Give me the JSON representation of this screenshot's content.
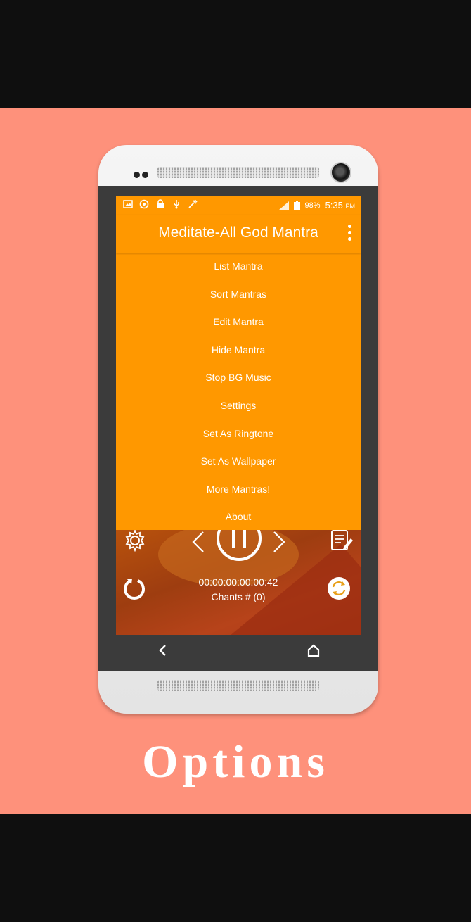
{
  "status_bar": {
    "battery": "98%",
    "time": "5:35",
    "ampm": "PM",
    "left_icons": [
      "image-icon",
      "whatsapp-icon",
      "lock-icon",
      "usb-icon",
      "tool-icon"
    ],
    "right_icons": [
      "signal-icon",
      "battery-icon"
    ]
  },
  "app": {
    "title": "Meditate-All God Mantra",
    "overflow_icon": "kebab-menu-icon"
  },
  "menu": {
    "items": [
      {
        "label": "List Mantra"
      },
      {
        "label": "Sort Mantras"
      },
      {
        "label": "Edit Mantra"
      },
      {
        "label": "Hide Mantra"
      },
      {
        "label": "Stop BG Music"
      },
      {
        "label": "Settings"
      },
      {
        "label": "Set As Ringtone"
      },
      {
        "label": "Set As Wallpaper"
      },
      {
        "label": "More Mantras!"
      },
      {
        "label": "About"
      }
    ]
  },
  "player": {
    "timer": "00:00:00:00:00:42",
    "chants": "Chants # (0)",
    "icons": [
      "gear-icon",
      "prev-icon",
      "pause-icon",
      "next-icon",
      "notes-icon",
      "reset-icon",
      "shuffle-icon"
    ]
  },
  "navbar": {
    "icons": [
      "back-icon",
      "home-icon"
    ]
  },
  "caption": "Options",
  "colors": {
    "poster_bg": "#fe917b",
    "app_orange": "#ff9800",
    "outer_bg": "#0f0f0f"
  }
}
